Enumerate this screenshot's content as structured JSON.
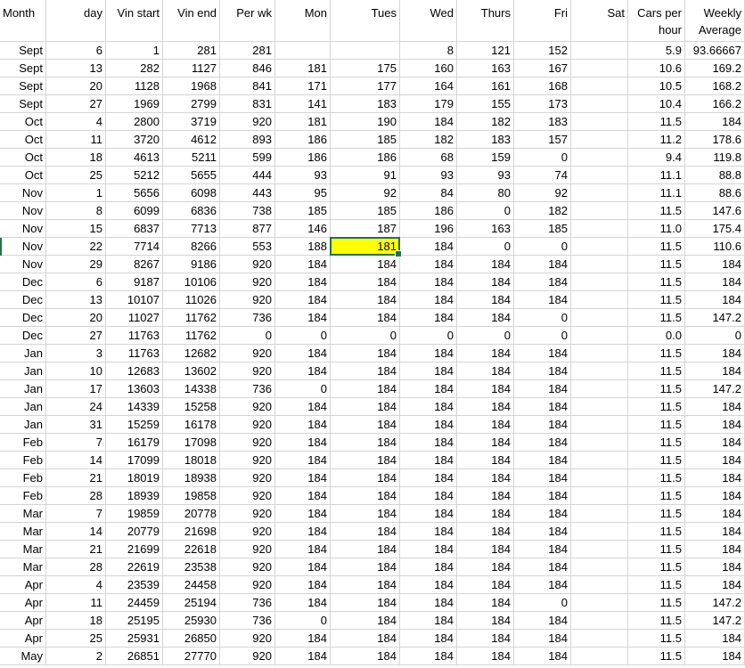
{
  "headers": [
    "Month",
    "day",
    "Vin start",
    "Vin end",
    "Per wk",
    "Mon",
    "Tues",
    "Wed",
    "Thurs",
    "Fri",
    "Sat",
    "Cars per hour",
    "Weekly Average"
  ],
  "selected_cell": {
    "row": 11,
    "col": 6,
    "value": "181"
  },
  "selection_color": "#ffff00",
  "accent_color": "#217346",
  "rows": [
    [
      "Sept",
      "6",
      "1",
      "281",
      "281",
      "",
      "",
      "8",
      "121",
      "152",
      "",
      "5.9",
      "93.66667"
    ],
    [
      "Sept",
      "13",
      "282",
      "1127",
      "846",
      "181",
      "175",
      "160",
      "163",
      "167",
      "",
      "10.6",
      "169.2"
    ],
    [
      "Sept",
      "20",
      "1128",
      "1968",
      "841",
      "171",
      "177",
      "164",
      "161",
      "168",
      "",
      "10.5",
      "168.2"
    ],
    [
      "Sept",
      "27",
      "1969",
      "2799",
      "831",
      "141",
      "183",
      "179",
      "155",
      "173",
      "",
      "10.4",
      "166.2"
    ],
    [
      "Oct",
      "4",
      "2800",
      "3719",
      "920",
      "181",
      "190",
      "184",
      "182",
      "183",
      "",
      "11.5",
      "184"
    ],
    [
      "Oct",
      "11",
      "3720",
      "4612",
      "893",
      "186",
      "185",
      "182",
      "183",
      "157",
      "",
      "11.2",
      "178.6"
    ],
    [
      "Oct",
      "18",
      "4613",
      "5211",
      "599",
      "186",
      "186",
      "68",
      "159",
      "0",
      "",
      "9.4",
      "119.8"
    ],
    [
      "Oct",
      "25",
      "5212",
      "5655",
      "444",
      "93",
      "91",
      "93",
      "93",
      "74",
      "",
      "11.1",
      "88.8"
    ],
    [
      "Nov",
      "1",
      "5656",
      "6098",
      "443",
      "95",
      "92",
      "84",
      "80",
      "92",
      "",
      "11.1",
      "88.6"
    ],
    [
      "Nov",
      "8",
      "6099",
      "6836",
      "738",
      "185",
      "185",
      "186",
      "0",
      "182",
      "",
      "11.5",
      "147.6"
    ],
    [
      "Nov",
      "15",
      "6837",
      "7713",
      "877",
      "146",
      "187",
      "196",
      "163",
      "185",
      "",
      "11.0",
      "175.4"
    ],
    [
      "Nov",
      "22",
      "7714",
      "8266",
      "553",
      "188",
      "181",
      "184",
      "0",
      "0",
      "",
      "11.5",
      "110.6"
    ],
    [
      "Nov",
      "29",
      "8267",
      "9186",
      "920",
      "184",
      "184",
      "184",
      "184",
      "184",
      "",
      "11.5",
      "184"
    ],
    [
      "Dec",
      "6",
      "9187",
      "10106",
      "920",
      "184",
      "184",
      "184",
      "184",
      "184",
      "",
      "11.5",
      "184"
    ],
    [
      "Dec",
      "13",
      "10107",
      "11026",
      "920",
      "184",
      "184",
      "184",
      "184",
      "184",
      "",
      "11.5",
      "184"
    ],
    [
      "Dec",
      "20",
      "11027",
      "11762",
      "736",
      "184",
      "184",
      "184",
      "184",
      "0",
      "",
      "11.5",
      "147.2"
    ],
    [
      "Dec",
      "27",
      "11763",
      "11762",
      "0",
      "0",
      "0",
      "0",
      "0",
      "0",
      "",
      "0.0",
      "0"
    ],
    [
      "Jan",
      "3",
      "11763",
      "12682",
      "920",
      "184",
      "184",
      "184",
      "184",
      "184",
      "",
      "11.5",
      "184"
    ],
    [
      "Jan",
      "10",
      "12683",
      "13602",
      "920",
      "184",
      "184",
      "184",
      "184",
      "184",
      "",
      "11.5",
      "184"
    ],
    [
      "Jan",
      "17",
      "13603",
      "14338",
      "736",
      "0",
      "184",
      "184",
      "184",
      "184",
      "",
      "11.5",
      "147.2"
    ],
    [
      "Jan",
      "24",
      "14339",
      "15258",
      "920",
      "184",
      "184",
      "184",
      "184",
      "184",
      "",
      "11.5",
      "184"
    ],
    [
      "Jan",
      "31",
      "15259",
      "16178",
      "920",
      "184",
      "184",
      "184",
      "184",
      "184",
      "",
      "11.5",
      "184"
    ],
    [
      "Feb",
      "7",
      "16179",
      "17098",
      "920",
      "184",
      "184",
      "184",
      "184",
      "184",
      "",
      "11.5",
      "184"
    ],
    [
      "Feb",
      "14",
      "17099",
      "18018",
      "920",
      "184",
      "184",
      "184",
      "184",
      "184",
      "",
      "11.5",
      "184"
    ],
    [
      "Feb",
      "21",
      "18019",
      "18938",
      "920",
      "184",
      "184",
      "184",
      "184",
      "184",
      "",
      "11.5",
      "184"
    ],
    [
      "Feb",
      "28",
      "18939",
      "19858",
      "920",
      "184",
      "184",
      "184",
      "184",
      "184",
      "",
      "11.5",
      "184"
    ],
    [
      "Mar",
      "7",
      "19859",
      "20778",
      "920",
      "184",
      "184",
      "184",
      "184",
      "184",
      "",
      "11.5",
      "184"
    ],
    [
      "Mar",
      "14",
      "20779",
      "21698",
      "920",
      "184",
      "184",
      "184",
      "184",
      "184",
      "",
      "11.5",
      "184"
    ],
    [
      "Mar",
      "21",
      "21699",
      "22618",
      "920",
      "184",
      "184",
      "184",
      "184",
      "184",
      "",
      "11.5",
      "184"
    ],
    [
      "Mar",
      "28",
      "22619",
      "23538",
      "920",
      "184",
      "184",
      "184",
      "184",
      "184",
      "",
      "11.5",
      "184"
    ],
    [
      "Apr",
      "4",
      "23539",
      "24458",
      "920",
      "184",
      "184",
      "184",
      "184",
      "184",
      "",
      "11.5",
      "184"
    ],
    [
      "Apr",
      "11",
      "24459",
      "25194",
      "736",
      "184",
      "184",
      "184",
      "184",
      "0",
      "",
      "11.5",
      "147.2"
    ],
    [
      "Apr",
      "18",
      "25195",
      "25930",
      "736",
      "0",
      "184",
      "184",
      "184",
      "184",
      "",
      "11.5",
      "147.2"
    ],
    [
      "Apr",
      "25",
      "25931",
      "26850",
      "920",
      "184",
      "184",
      "184",
      "184",
      "184",
      "",
      "11.5",
      "184"
    ],
    [
      "May",
      "2",
      "26851",
      "27770",
      "920",
      "184",
      "184",
      "184",
      "184",
      "184",
      "",
      "11.5",
      "184"
    ]
  ]
}
